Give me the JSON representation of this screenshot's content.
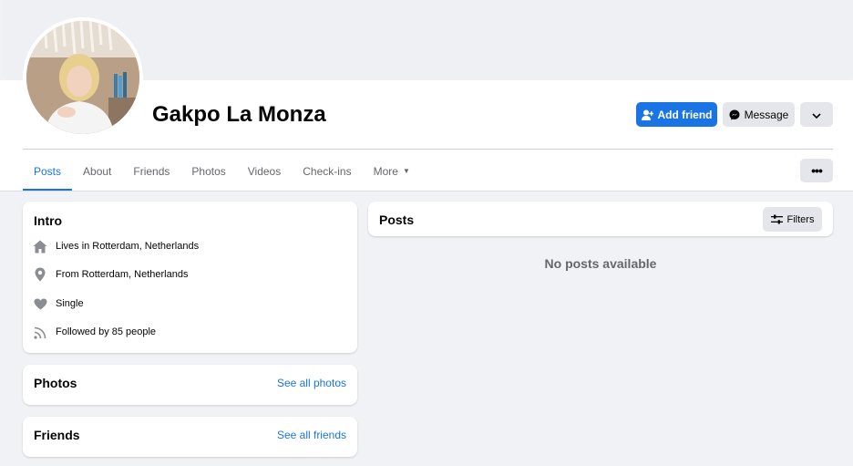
{
  "profile": {
    "name": "Gakpo La Monza"
  },
  "actions": {
    "add_friend": "Add friend",
    "message": "Message"
  },
  "tabs": [
    {
      "label": "Posts"
    },
    {
      "label": "About"
    },
    {
      "label": "Friends"
    },
    {
      "label": "Photos"
    },
    {
      "label": "Videos"
    },
    {
      "label": "Check-ins"
    },
    {
      "label": "More"
    }
  ],
  "intro": {
    "title": "Intro",
    "lives_prefix": "Lives in",
    "lives": "Rotterdam, Netherlands",
    "from_prefix": "From",
    "from": "Rotterdam, Netherlands",
    "relationship": "Single",
    "followed_prefix": "Followed by",
    "followers": "85 people"
  },
  "photos": {
    "title": "Photos",
    "link": "See all photos"
  },
  "friends": {
    "title": "Friends",
    "link": "See all friends"
  },
  "posts": {
    "title": "Posts",
    "filters": "Filters",
    "empty": "No posts available"
  },
  "colors": {
    "accent": "#1b74e4",
    "background": "#f0f2f5",
    "button_grey": "#e4e6eb"
  }
}
